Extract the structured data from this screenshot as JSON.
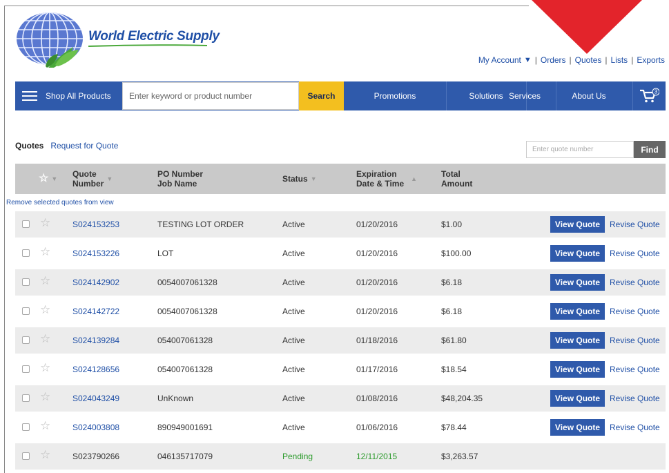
{
  "brand": {
    "name": "World Electric Supply"
  },
  "top_links": {
    "my_account": "My Account",
    "orders": "Orders",
    "quotes": "Quotes",
    "lists": "Lists",
    "exports": "Exports"
  },
  "nav": {
    "shop_all": "Shop All Products",
    "search_placeholder": "Enter keyword or product number",
    "search_button": "Search",
    "promotions": "Promotions",
    "solutions": "Solutions",
    "services": "Services",
    "about": "About Us",
    "cart_count": "3"
  },
  "tabs": {
    "quotes": "Quotes",
    "request": "Request for Quote"
  },
  "find": {
    "placeholder": "Enter quote number",
    "button": "Find"
  },
  "table": {
    "headers": {
      "quote_l1": "Quote",
      "quote_l2": "Number",
      "po_l1": "PO Number",
      "po_l2": "Job Name",
      "status": "Status",
      "exp_l1": "Expiration",
      "exp_l2": "Date & Time",
      "total_l1": "Total",
      "total_l2": "Amount"
    },
    "remove_link": "Remove selected quotes from view",
    "view_label": "View Quote",
    "revise_label": "Revise Quote",
    "rows": [
      {
        "quote": "S024153253",
        "po": "TESTING LOT ORDER",
        "status": "Active",
        "date": "01/20/2016",
        "total": "$1.00"
      },
      {
        "quote": "S024153226",
        "po": "LOT",
        "status": "Active",
        "date": "01/20/2016",
        "total": "$100.00"
      },
      {
        "quote": "S024142902",
        "po": "0054007061328",
        "status": "Active",
        "date": "01/20/2016",
        "total": "$6.18"
      },
      {
        "quote": "S024142722",
        "po": "0054007061328",
        "status": "Active",
        "date": "01/20/2016",
        "total": "$6.18"
      },
      {
        "quote": "S024139284",
        "po": "054007061328",
        "status": "Active",
        "date": "01/18/2016",
        "total": "$61.80"
      },
      {
        "quote": "S024128656",
        "po": "054007061328",
        "status": "Active",
        "date": "01/17/2016",
        "total": "$18.54"
      },
      {
        "quote": "S024043249",
        "po": "UnKnown",
        "status": "Active",
        "date": "01/08/2016",
        "total": "$48,204.35"
      },
      {
        "quote": "S024003808",
        "po": "890949001691",
        "status": "Active",
        "date": "01/06/2016",
        "total": "$78.44"
      },
      {
        "quote": "S023790266",
        "po": "046135717079",
        "status": "Pending",
        "date": "12/11/2015",
        "total": "$3,263.57"
      }
    ]
  },
  "colors": {
    "nav_blue": "#2f5aab",
    "search_yellow": "#f3bf1f",
    "link_blue": "#1f4fa6",
    "pending_green": "#2d9b2d",
    "arrow_red": "#e3242b"
  }
}
